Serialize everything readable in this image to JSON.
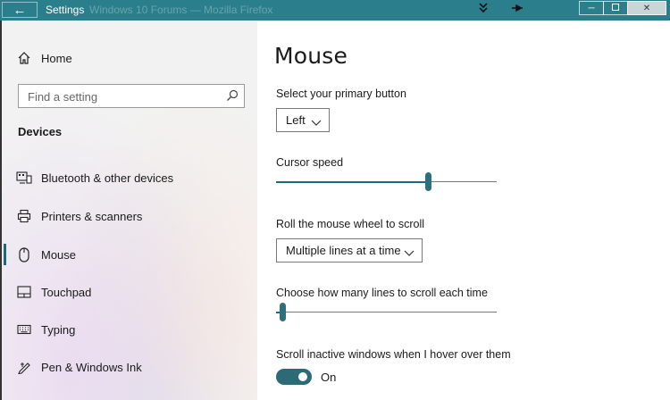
{
  "window": {
    "back_glyph": "←",
    "title": "Settings",
    "ghost_title": "Windows 10 Forums — Mozilla Firefox",
    "minimize_glyph": "─",
    "close_glyph": "✕"
  },
  "sidebar": {
    "home_label": "Home",
    "search_placeholder": "Find a setting",
    "section": "Devices",
    "items": [
      {
        "label": "Bluetooth & other devices",
        "icon": "bluetooth-devices-icon"
      },
      {
        "label": "Printers & scanners",
        "icon": "printer-icon"
      },
      {
        "label": "Mouse",
        "icon": "mouse-icon",
        "selected": true
      },
      {
        "label": "Touchpad",
        "icon": "touchpad-icon"
      },
      {
        "label": "Typing",
        "icon": "keyboard-icon"
      },
      {
        "label": "Pen & Windows Ink",
        "icon": "pen-icon"
      }
    ]
  },
  "main": {
    "title": "Mouse",
    "primary_button": {
      "label": "Select your primary button",
      "value": "Left"
    },
    "cursor_speed": {
      "label": "Cursor speed",
      "level": 0.69
    },
    "scroll_wheel": {
      "label": "Roll the mouse wheel to scroll",
      "value": "Multiple lines at a time"
    },
    "scroll_lines": {
      "label": "Choose how many lines to scroll each time",
      "level": 0.03
    },
    "inactive_scroll": {
      "label": "Scroll inactive windows when I hover over them",
      "state": "On"
    }
  },
  "colors": {
    "titlebar": "#2b7f8c",
    "accent": "#2d6a78",
    "sidebar_bg": "#f2f2f2"
  }
}
